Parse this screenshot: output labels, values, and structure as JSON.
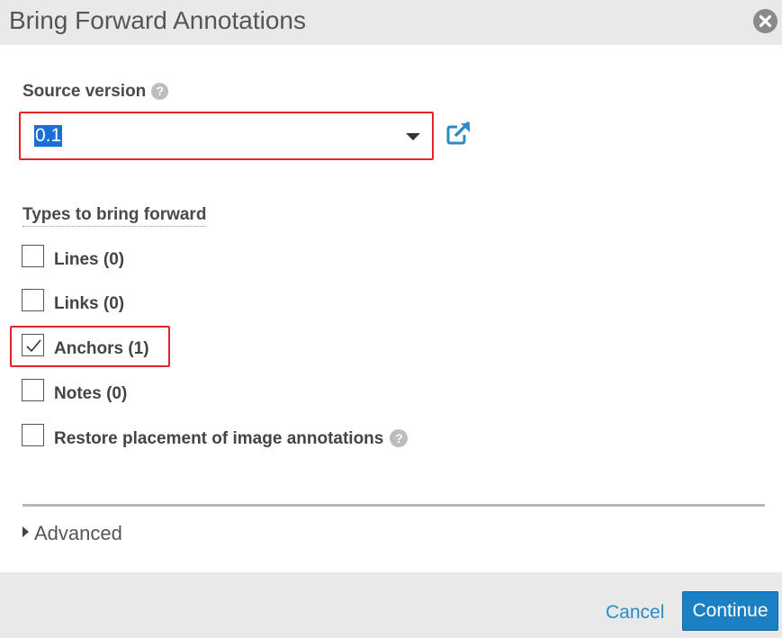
{
  "dialog": {
    "title": "Bring Forward Annotations"
  },
  "source_version": {
    "label": "Source version",
    "selected": "0.1"
  },
  "types": {
    "label": "Types to bring forward",
    "options": [
      {
        "label": "Lines (0)",
        "checked": false
      },
      {
        "label": "Links (0)",
        "checked": false
      },
      {
        "label": "Anchors (1)",
        "checked": true
      },
      {
        "label": "Notes (0)",
        "checked": false
      },
      {
        "label": "Restore placement of image annotations",
        "checked": false
      }
    ]
  },
  "advanced": {
    "label": "Advanced"
  },
  "footer": {
    "cancel_label": "Cancel",
    "continue_label": "Continue"
  },
  "icons": {
    "help": "?"
  },
  "colors": {
    "accent": "#1b7fc4",
    "highlight": "#e3242b",
    "link": "#2a8cc7"
  }
}
